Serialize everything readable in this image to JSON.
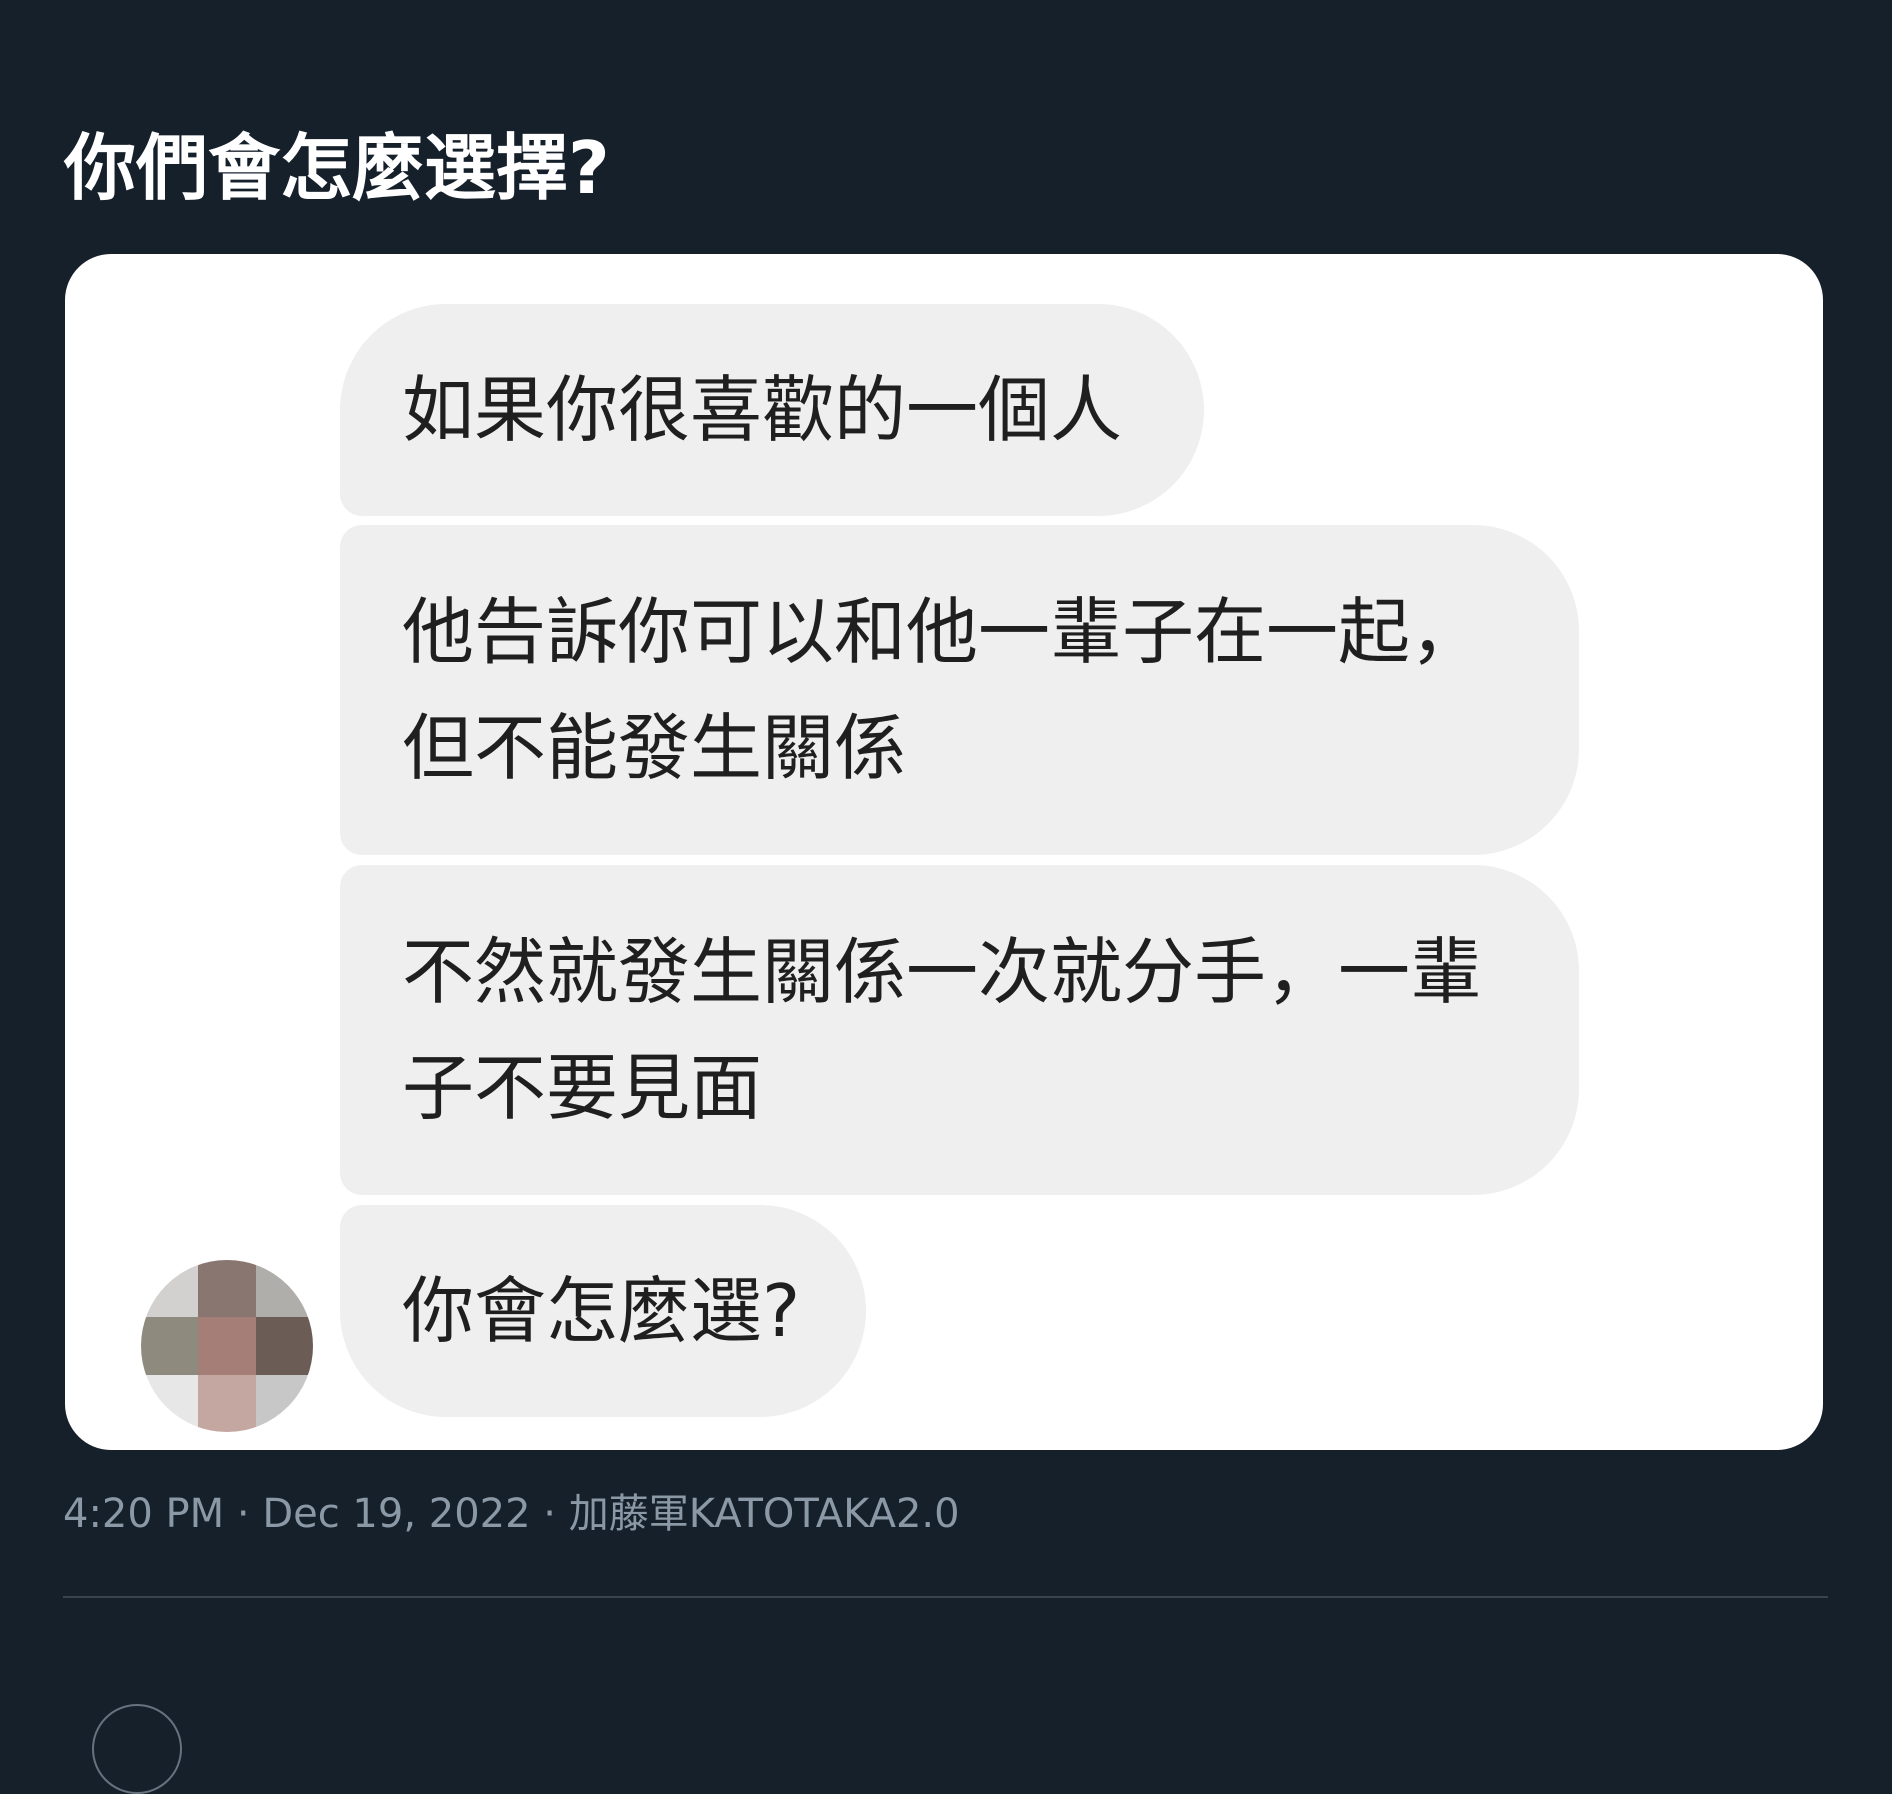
{
  "tweet": {
    "text": "你們會怎麼選擇?",
    "meta": "4:20 PM · Dec 19, 2022 · 加藤軍KATOTAKA2.0"
  },
  "chat_screenshot": {
    "messages": [
      {
        "text": "如果你很喜歡的一個人"
      },
      {
        "text": "他告訴你可以和他一輩子在一起，\n但不能發生關係"
      },
      {
        "text": "不然就發生關係一次就分手，一輩\n子不要見面"
      },
      {
        "text": "你會怎麼選?"
      }
    ]
  },
  "colors": {
    "background": "#15202b",
    "bubble": "#efefef",
    "meta_text": "#8b98a5",
    "divider": "#38444d"
  },
  "icons": {
    "avatar": "blurred-profile-avatar"
  }
}
